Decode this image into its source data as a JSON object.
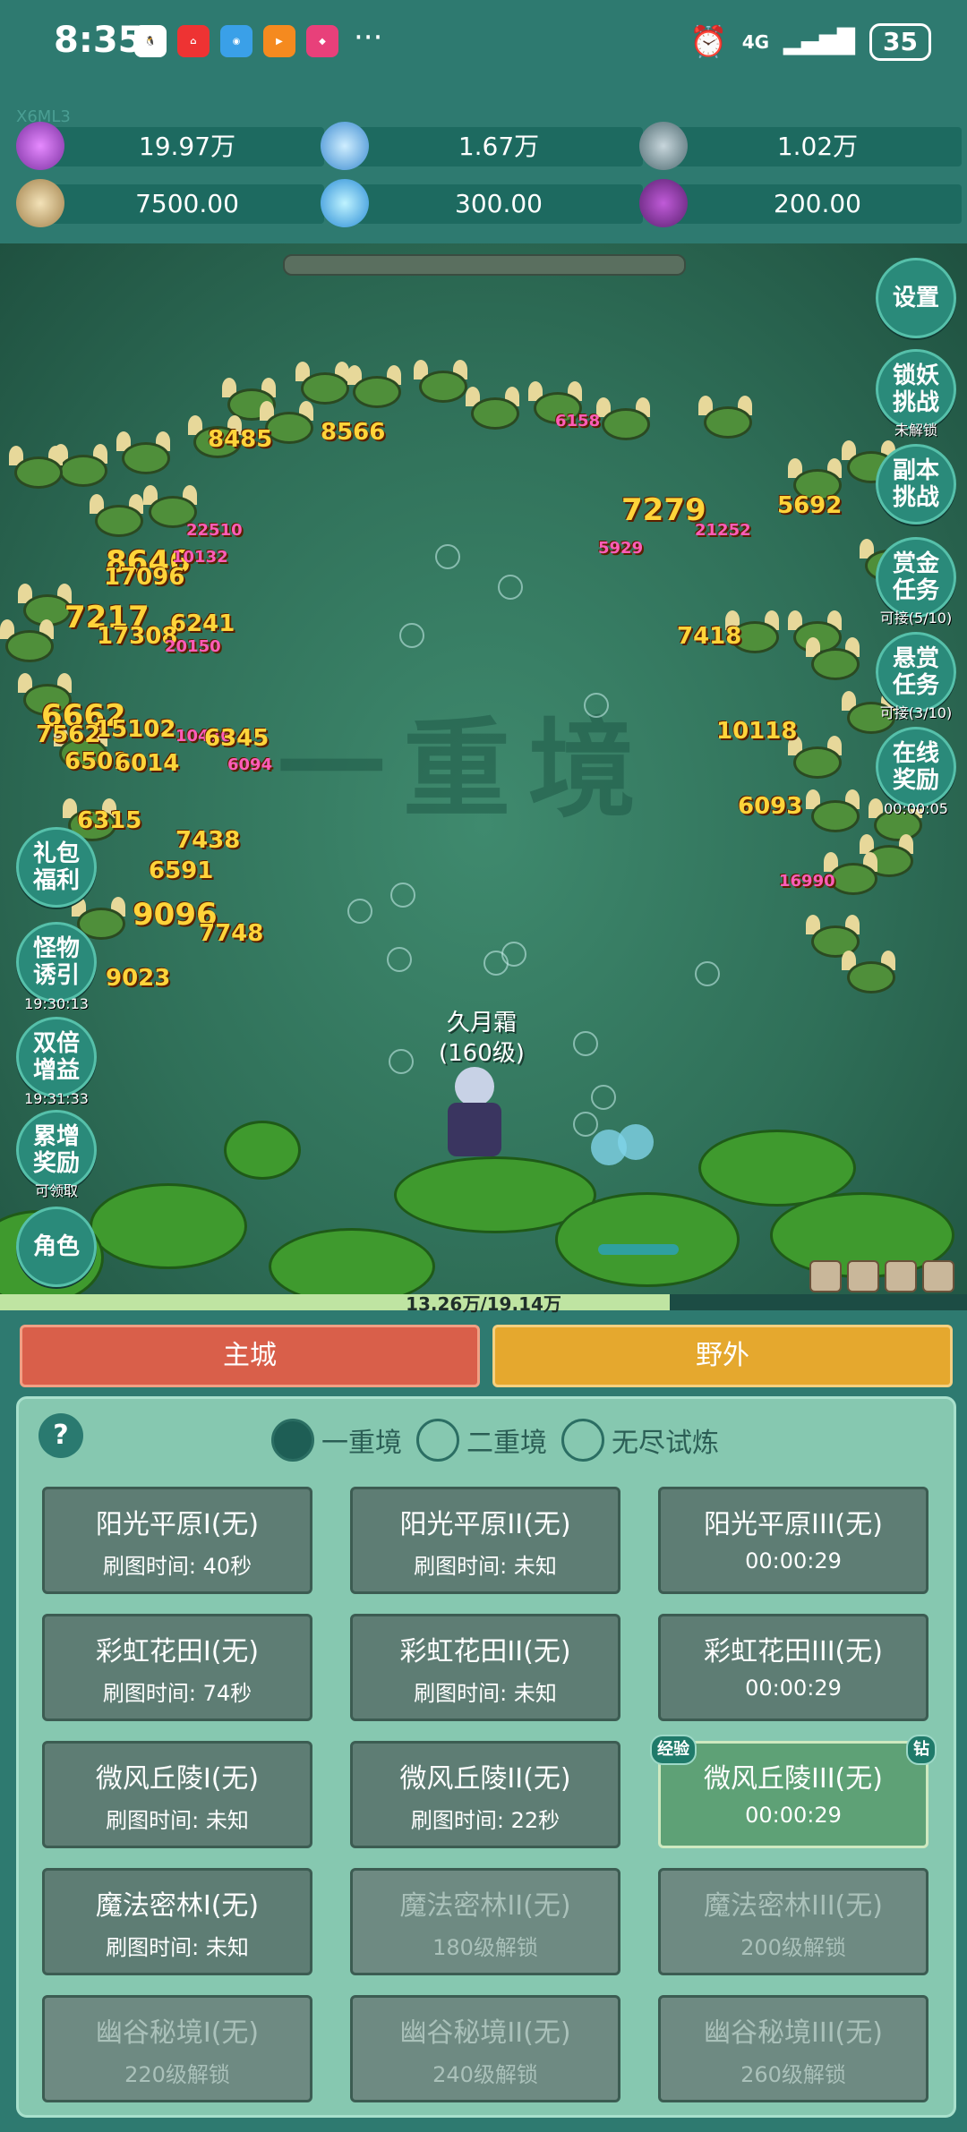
{
  "status_bar": {
    "time": "8:35",
    "battery": "35",
    "signal": "4G",
    "more": "···"
  },
  "resources": {
    "top_label": "X6ML3",
    "items": [
      {
        "icon": "purple-gem-icon",
        "value": "19.97万"
      },
      {
        "icon": "blue-crystal-icon",
        "value": "1.67万"
      },
      {
        "icon": "gray-orb-icon",
        "value": "1.02万"
      },
      {
        "icon": "scroll-icon",
        "value": "7500.00"
      },
      {
        "icon": "ice-shard-icon",
        "value": "300.00"
      },
      {
        "icon": "purple-pot-icon",
        "value": "200.00"
      }
    ]
  },
  "scene": {
    "realm_name": "一重境",
    "hero": {
      "name": "久月霜",
      "level": "(160级)"
    },
    "exp": {
      "text": "13.26万/19.14万",
      "fraction": 0.6928
    },
    "damage_numbers": [
      {
        "text": "8485",
        "cls": "y"
      },
      {
        "text": "8566",
        "cls": "y"
      },
      {
        "text": "6158",
        "cls": "p"
      },
      {
        "text": "7279",
        "cls": "y big"
      },
      {
        "text": "21252",
        "cls": "p"
      },
      {
        "text": "5692",
        "cls": "y"
      },
      {
        "text": "5929",
        "cls": "p"
      },
      {
        "text": "22510",
        "cls": "p"
      },
      {
        "text": "8646",
        "cls": "y big"
      },
      {
        "text": "10132",
        "cls": "p"
      },
      {
        "text": "17096",
        "cls": "y"
      },
      {
        "text": "7217",
        "cls": "y big"
      },
      {
        "text": "6241",
        "cls": "y"
      },
      {
        "text": "17308",
        "cls": "y"
      },
      {
        "text": "20150",
        "cls": "p"
      },
      {
        "text": "7418",
        "cls": "y"
      },
      {
        "text": "6662",
        "cls": "y big"
      },
      {
        "text": "15102",
        "cls": "y"
      },
      {
        "text": "7562",
        "cls": "y"
      },
      {
        "text": "10436",
        "cls": "p"
      },
      {
        "text": "6345",
        "cls": "y"
      },
      {
        "text": "6501",
        "cls": "y"
      },
      {
        "text": "6014",
        "cls": "y"
      },
      {
        "text": "6094",
        "cls": "p"
      },
      {
        "text": "10118",
        "cls": "y"
      },
      {
        "text": "6093",
        "cls": "y"
      },
      {
        "text": "6315",
        "cls": "y"
      },
      {
        "text": "7438",
        "cls": "y"
      },
      {
        "text": "6591",
        "cls": "y"
      },
      {
        "text": "16990",
        "cls": "p"
      },
      {
        "text": "9096",
        "cls": "y big"
      },
      {
        "text": "7748",
        "cls": "y"
      },
      {
        "text": "9023",
        "cls": "y"
      }
    ]
  },
  "side_buttons": {
    "settings": "设置",
    "lock_demon": {
      "label": "锁妖\n挑战",
      "sub": "未解锁"
    },
    "dungeon": {
      "label": "副本\n挑战"
    },
    "reward_task": {
      "label": "赏金\n任务",
      "sub": "可接(5/10)"
    },
    "bounty_task": {
      "label": "悬赏\n任务",
      "sub": "可接(3/10)"
    },
    "online_reward": {
      "label": "在线\n奖励",
      "sub": "00:00:05"
    },
    "gift": {
      "label": "礼包\n福利"
    },
    "monster_lure": {
      "label": "怪物\n诱引",
      "sub": "19:30:13"
    },
    "double_gain": {
      "label": "双倍\n增益",
      "sub": "19:31:33"
    },
    "accum_reward": {
      "label": "累增\n奖励",
      "sub": "可领取"
    },
    "character": {
      "label": "角色"
    }
  },
  "nav": {
    "city": "主城",
    "wild": "野外"
  },
  "panel": {
    "help": "?",
    "tabs": [
      {
        "label": "一重境",
        "selected": true
      },
      {
        "label": "二重境",
        "selected": false
      },
      {
        "label": "无尽试炼",
        "selected": false
      }
    ],
    "tags": {
      "exp": "经验",
      "diamond": "钻"
    },
    "maps": [
      {
        "name": "阳光平原I(无)",
        "time": "刷图时间: 40秒",
        "state": "normal"
      },
      {
        "name": "阳光平原II(无)",
        "time": "刷图时间: 未知",
        "state": "normal"
      },
      {
        "name": "阳光平原III(无)",
        "time": "00:00:29",
        "state": "normal"
      },
      {
        "name": "彩虹花田I(无)",
        "time": "刷图时间: 74秒",
        "state": "normal"
      },
      {
        "name": "彩虹花田II(无)",
        "time": "刷图时间: 未知",
        "state": "normal"
      },
      {
        "name": "彩虹花田III(无)",
        "time": "00:00:29",
        "state": "normal"
      },
      {
        "name": "微风丘陵I(无)",
        "time": "刷图时间: 未知",
        "state": "normal"
      },
      {
        "name": "微风丘陵II(无)",
        "time": "刷图时间: 22秒",
        "state": "normal"
      },
      {
        "name": "微风丘陵III(无)",
        "time": "00:00:29",
        "state": "active"
      },
      {
        "name": "魔法密林I(无)",
        "time": "刷图时间: 未知",
        "state": "normal"
      },
      {
        "name": "魔法密林II(无)",
        "time": "180级解锁",
        "state": "locked"
      },
      {
        "name": "魔法密林III(无)",
        "time": "200级解锁",
        "state": "locked"
      },
      {
        "name": "幽谷秘境I(无)",
        "time": "220级解锁",
        "state": "locked"
      },
      {
        "name": "幽谷秘境II(无)",
        "time": "240级解锁",
        "state": "locked"
      },
      {
        "name": "幽谷秘境III(无)",
        "time": "260级解锁",
        "state": "locked"
      }
    ]
  }
}
